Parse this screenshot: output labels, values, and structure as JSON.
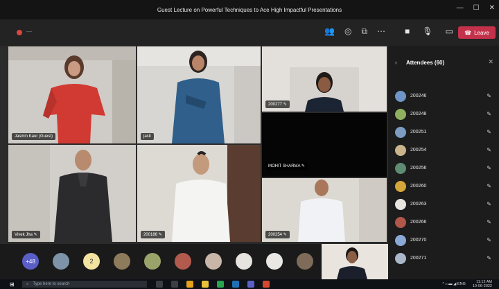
{
  "window": {
    "title": "Guest Lecture on Powerful Techniques to Ace High Impactful Presentations",
    "controls": [
      "—",
      "☐",
      "✕"
    ]
  },
  "toolbar": {
    "timer": "—",
    "icons": [
      "people-icon",
      "chat-icon",
      "rooms-icon",
      "more-icon"
    ],
    "device_icons": [
      "camera-icon",
      "mic-icon",
      "share-icon"
    ],
    "leave_label": "Leave",
    "colors": {
      "leave": "#c4314b"
    }
  },
  "tiles": [
    {
      "name": "Jasmin Kaur (Guest)"
    },
    {
      "name": "jasti"
    },
    {
      "name": "200277"
    },
    {
      "name": "MOHIT SHARMA"
    },
    {
      "name": "Vivek Jha"
    },
    {
      "name": "200186"
    },
    {
      "name": "200254"
    }
  ],
  "attendees_panel": {
    "title": "Attendees (60)",
    "items": [
      {
        "label": "200246"
      },
      {
        "label": "200248"
      },
      {
        "label": "200251"
      },
      {
        "label": "200254"
      },
      {
        "label": "200256"
      },
      {
        "label": "200260"
      },
      {
        "label": "200263"
      },
      {
        "label": "200266"
      },
      {
        "label": "200270"
      },
      {
        "label": "200271"
      }
    ]
  },
  "bottom_strip": {
    "overflow_label": "+48",
    "initials": "2"
  },
  "taskbar": {
    "search_placeholder": "Type here to search",
    "tray": "^ ⌂ ▬ ◢ ENG",
    "time": "11:12 AM",
    "date": "10-06-2022"
  }
}
